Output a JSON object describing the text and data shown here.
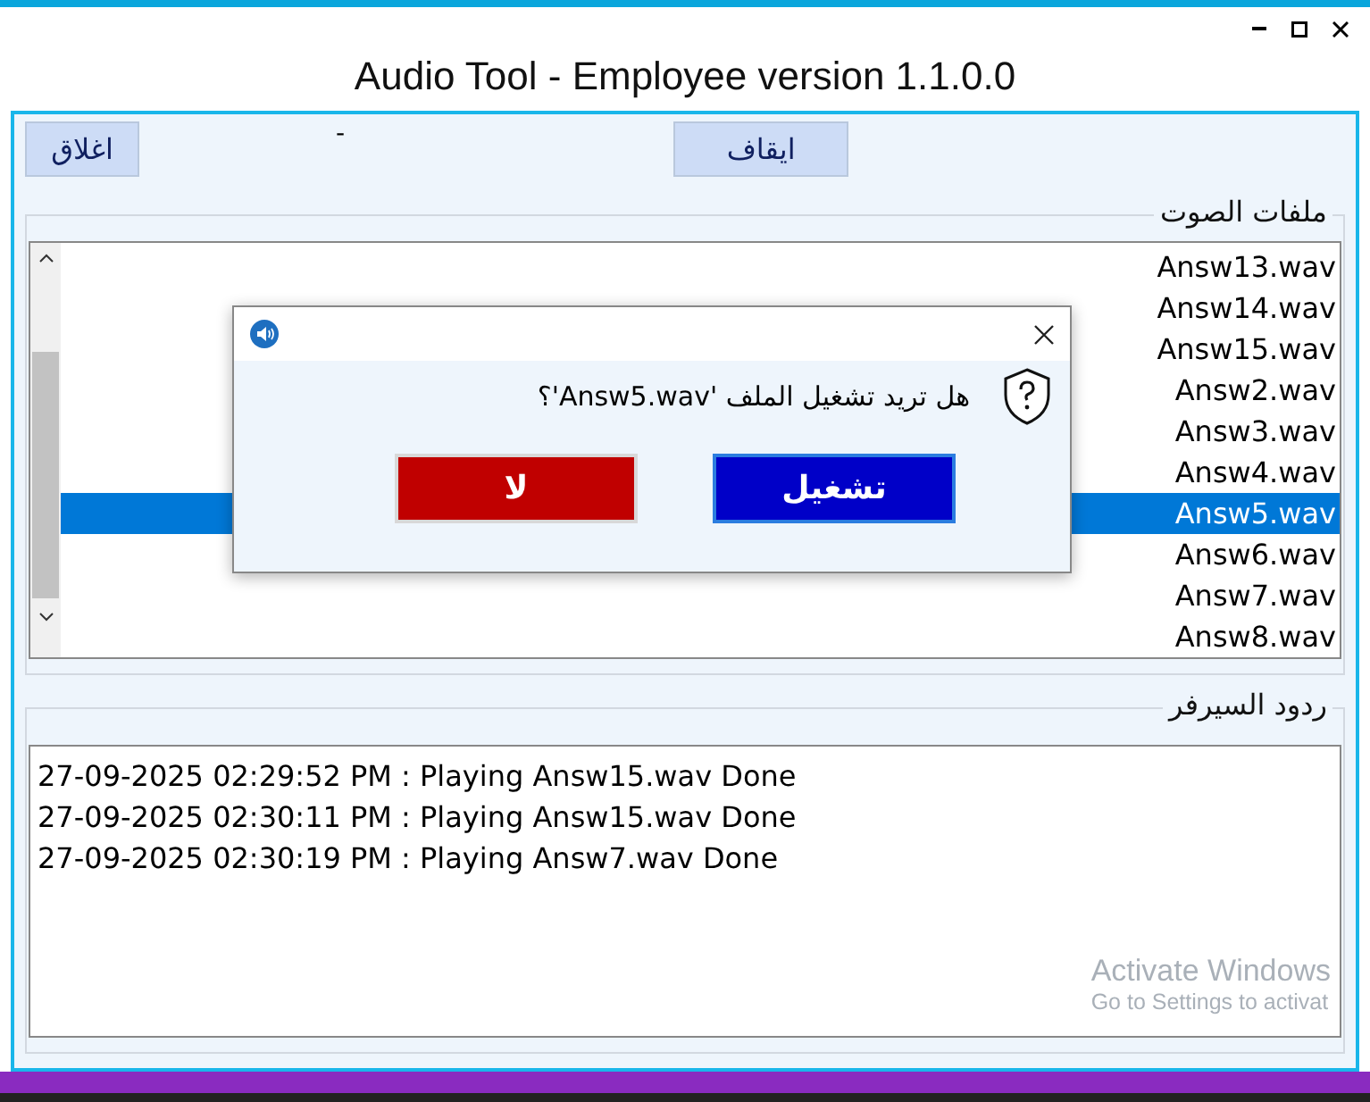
{
  "window": {
    "title": "Audio Tool - Employee version 1.1.0.0"
  },
  "toolbar": {
    "close_button": "اغلاق",
    "status_label": "-",
    "stop_button": "ايقاف"
  },
  "files_group": {
    "title": "ملفات الصوت",
    "items": [
      {
        "label": "Answ13.wav",
        "selected": false
      },
      {
        "label": "Answ14.wav",
        "selected": false
      },
      {
        "label": "Answ15.wav",
        "selected": false
      },
      {
        "label": "Answ2.wav",
        "selected": false
      },
      {
        "label": "Answ3.wav",
        "selected": false
      },
      {
        "label": "Answ4.wav",
        "selected": false
      },
      {
        "label": "Answ5.wav",
        "selected": true
      },
      {
        "label": "Answ6.wav",
        "selected": false
      },
      {
        "label": "Answ7.wav",
        "selected": false
      },
      {
        "label": "Answ8.wav",
        "selected": false
      }
    ]
  },
  "server_group": {
    "title": "ردود السيرفر",
    "lines": [
      "27-09-2025 02:29:52 PM : Playing Answ15.wav Done",
      "27-09-2025 02:30:11 PM : Playing Answ15.wav Done",
      "27-09-2025 02:30:19 PM : Playing Answ7.wav Done"
    ]
  },
  "dialog": {
    "message": "هل تريد تشغيل الملف 'Answ5.wav'؟",
    "buttons": [
      {
        "label": "تشغيل",
        "kind": "confirm"
      },
      {
        "label": "لا",
        "kind": "cancel"
      }
    ]
  },
  "os_notice": {
    "title": "Activate Windows",
    "subtitle": "Go to Settings to activat"
  }
}
